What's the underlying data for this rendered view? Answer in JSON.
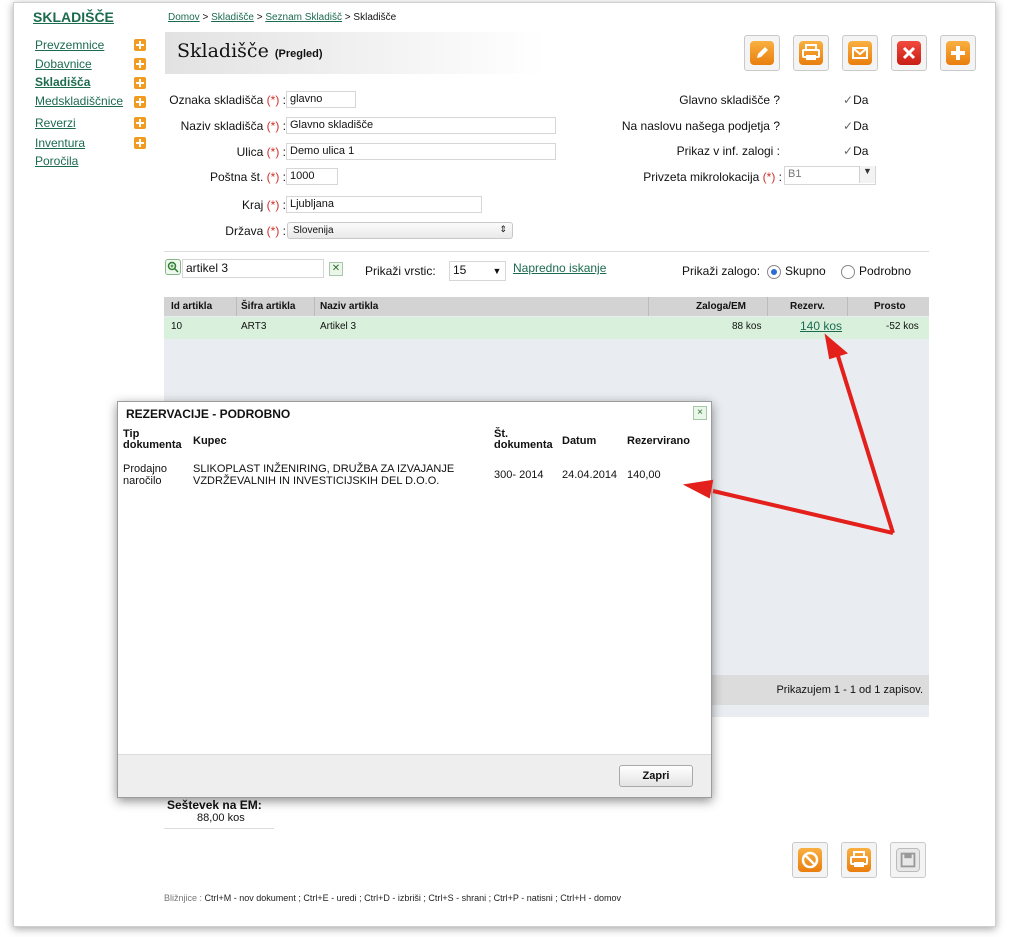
{
  "sidebar": {
    "title": "SKLADIŠČE",
    "items": [
      {
        "label": "Prevzemnice",
        "has_add": true
      },
      {
        "label": "Dobavnice",
        "has_add": true
      },
      {
        "label": "Skladišča",
        "has_add": true,
        "active": true
      },
      {
        "label": "Medskladiščnice",
        "has_add": true
      },
      {
        "label": "Reverzi",
        "has_add": true
      },
      {
        "label": "Inventura",
        "has_add": true
      },
      {
        "label": "Poročila",
        "has_add": false
      }
    ]
  },
  "breadcrumb": {
    "home": "Domov",
    "sep": ">",
    "level1": "Skladišče",
    "level2": "Seznam Skladišč",
    "current": "Skladišče"
  },
  "page": {
    "title": "Skladišče",
    "subtitle": "(Pregled)"
  },
  "toolbar": {
    "icons": [
      "edit-icon",
      "print-icon",
      "email-icon",
      "delete-icon",
      "add-icon"
    ]
  },
  "form": {
    "required_mark": "(*)",
    "fields": [
      {
        "label": "Oznaka skladišča",
        "value": "glavno"
      },
      {
        "label": "Naziv skladišča",
        "value": "Glavno skladišče"
      },
      {
        "label": "Ulica",
        "value": "Demo ulica 1"
      },
      {
        "label": "Poštna št.",
        "value": "1000"
      },
      {
        "label": "Kraj",
        "value": "Ljubljana"
      },
      {
        "label": "Država",
        "value": "Slovenija"
      }
    ],
    "right": [
      {
        "label": "Glavno skladišče ?",
        "value": "Da"
      },
      {
        "label": "Na naslovu našega podjetja ?",
        "value": "Da"
      },
      {
        "label": "Prikaz v inf. zalogi :",
        "value": "Da"
      }
    ],
    "microloc": {
      "label": "Privzeta mikrolokacija",
      "value": "B1"
    }
  },
  "search": {
    "value": "artikel 3",
    "rows_label": "Prikaži vrstic:",
    "rows_value": "15",
    "advanced": "Napredno iskanje",
    "stock_label": "Prikaži zalogo:",
    "opt_group": "Skupno",
    "opt_detail": "Podrobno",
    "selected": "Skupno"
  },
  "grid": {
    "columns": [
      "Id artikla",
      "Šifra artikla",
      "Naziv artikla",
      "Zaloga/EM",
      "Rezerv.",
      "Prosto"
    ],
    "rows": [
      {
        "id": "10",
        "code": "ART3",
        "name": "Artikel 3",
        "stock": "88 kos",
        "reserved": "140 kos",
        "free": "-52 kos"
      }
    ],
    "footer": "Prikazujem 1 - 1 od 1 zapisov."
  },
  "modal": {
    "title": "REZERVACIJE - PODROBNO",
    "close": "×",
    "col_type": "Tip\ndokumenta",
    "col_customer": "Kupec",
    "col_docno": "Št.\ndokumenta",
    "col_date": "Datum",
    "col_reserved": "Rezervirano",
    "row": {
      "type": "Prodajno\nnaročilo",
      "customer": "SLIKOPLAST INŽENIRING, DRUŽBA ZA IZVAJANJE\nVZDRŽEVALNIH IN INVESTICIJSKIH DEL D.O.O.",
      "docno": "300- 2014",
      "date": "24.04.2014",
      "reserved": "140,00"
    },
    "button": "Zapri"
  },
  "summary": {
    "label": "Seštevek na EM:",
    "value": "88,00 kos"
  },
  "bottom_toolbar": {
    "icons": [
      "cancel-icon",
      "print-icon",
      "save-icon"
    ]
  },
  "shortcuts": {
    "label": "Bližnjice :",
    "text": "Ctrl+M - nov dokument ;  Ctrl+E - uredi ;  Ctrl+D - izbriši ;  Ctrl+S - shrani ;  Ctrl+P - natisni ;  Ctrl+H - domov"
  },
  "colors": {
    "link": "#1c6b4f",
    "required": "#d0302a",
    "row_highlight": "#d9f1dc",
    "arrow": "#e3201b",
    "icon_orange": "#f39a21"
  }
}
